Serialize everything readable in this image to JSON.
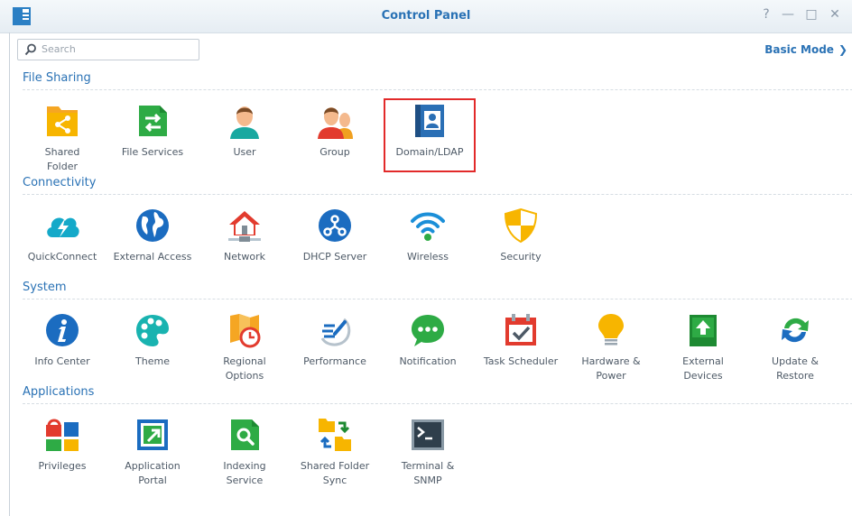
{
  "window": {
    "title": "Control Panel",
    "help_glyph": "?",
    "minimize_glyph": "—",
    "maximize_glyph": "□",
    "close_glyph": "✕"
  },
  "toolbar": {
    "search_placeholder": "Search",
    "basic_mode_label": "Basic Mode",
    "basic_mode_glyph": "❯"
  },
  "sections": [
    {
      "title": "File Sharing",
      "items": [
        {
          "label": "Shared\nFolder",
          "icon": "shared-folder-icon"
        },
        {
          "label": "File Services",
          "icon": "file-services-icon"
        },
        {
          "label": "User",
          "icon": "user-icon"
        },
        {
          "label": "Group",
          "icon": "group-icon"
        },
        {
          "label": "Domain/LDAP",
          "icon": "domain-ldap-icon",
          "highlighted": true
        }
      ]
    },
    {
      "title": "Connectivity",
      "items": [
        {
          "label": "QuickConnect",
          "icon": "quickconnect-icon"
        },
        {
          "label": "External Access",
          "icon": "external-access-icon"
        },
        {
          "label": "Network",
          "icon": "network-icon"
        },
        {
          "label": "DHCP Server",
          "icon": "dhcp-server-icon"
        },
        {
          "label": "Wireless",
          "icon": "wireless-icon"
        },
        {
          "label": "Security",
          "icon": "security-icon"
        }
      ]
    },
    {
      "title": "System",
      "items": [
        {
          "label": "Info Center",
          "icon": "info-center-icon"
        },
        {
          "label": "Theme",
          "icon": "theme-icon"
        },
        {
          "label": "Regional\nOptions",
          "icon": "regional-options-icon"
        },
        {
          "label": "Performance",
          "icon": "performance-icon"
        },
        {
          "label": "Notification",
          "icon": "notification-icon"
        },
        {
          "label": "Task Scheduler",
          "icon": "task-scheduler-icon"
        },
        {
          "label": "Hardware &\nPower",
          "icon": "hardware-power-icon"
        },
        {
          "label": "External\nDevices",
          "icon": "external-devices-icon"
        },
        {
          "label": "Update &\nRestore",
          "icon": "update-restore-icon"
        }
      ]
    },
    {
      "title": "Applications",
      "items": [
        {
          "label": "Privileges",
          "icon": "privileges-icon"
        },
        {
          "label": "Application\nPortal",
          "icon": "application-portal-icon"
        },
        {
          "label": "Indexing\nService",
          "icon": "indexing-service-icon"
        },
        {
          "label": "Shared Folder\nSync",
          "icon": "shared-folder-sync-icon"
        },
        {
          "label": "Terminal &\nSNMP",
          "icon": "terminal-snmp-icon"
        }
      ]
    }
  ],
  "colors": {
    "accent": "#2a72b5",
    "highlight_border": "#e22a2a"
  }
}
